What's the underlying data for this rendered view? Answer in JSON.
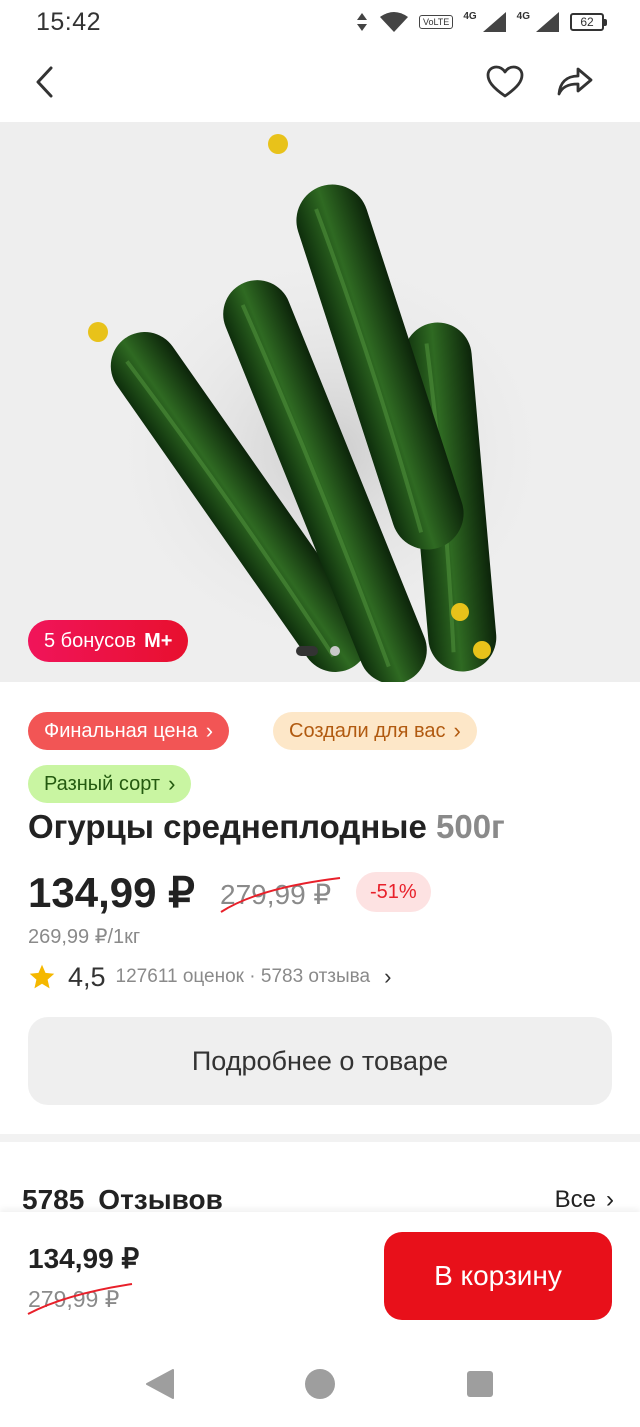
{
  "status_bar": {
    "time": "15:42",
    "network_1": "4G",
    "network_2": "4G",
    "volte": "VoLTE",
    "battery": "62",
    "icons": [
      "data-arrows-icon",
      "wifi-icon",
      "volte-icon",
      "signal-icon",
      "signal-icon",
      "battery-icon"
    ]
  },
  "top_nav": {
    "icons": [
      "back-arrow-icon",
      "heart-icon",
      "share-icon"
    ]
  },
  "gallery": {
    "bonus_text": "5 бонусов",
    "bonus_brand": "М+",
    "image_count": 2,
    "active_image": 1
  },
  "chips": {
    "final_price": "Финальная цена",
    "made_for_you": "Создали для вас",
    "variety": "Разный сорт",
    "chevron": "›"
  },
  "product": {
    "name": "Огурцы среднеплодные",
    "weight": "500г",
    "price": "134,99 ₽",
    "old_price": "279,99 ₽",
    "discount": "-51%",
    "unit_price": "269,99 ₽/1кг",
    "rating": "4,5",
    "rating_meta": "127611 оценок · 5783 отзыва"
  },
  "details_button": "Подробнее о товаре",
  "reviews": {
    "count": "5785",
    "label": "Отзывов",
    "all": "Все"
  },
  "buy_bar": {
    "price": "134,99 ₽",
    "old_price": "279,99 ₽",
    "cart_button": "В корзину"
  },
  "colors": {
    "accent_red": "#e8101a",
    "chip_red": "#f25555",
    "chip_peach": "#fde7c8",
    "chip_green": "#c9f5a2",
    "discount_bg": "#fde2e2",
    "star": "#f5b800"
  }
}
